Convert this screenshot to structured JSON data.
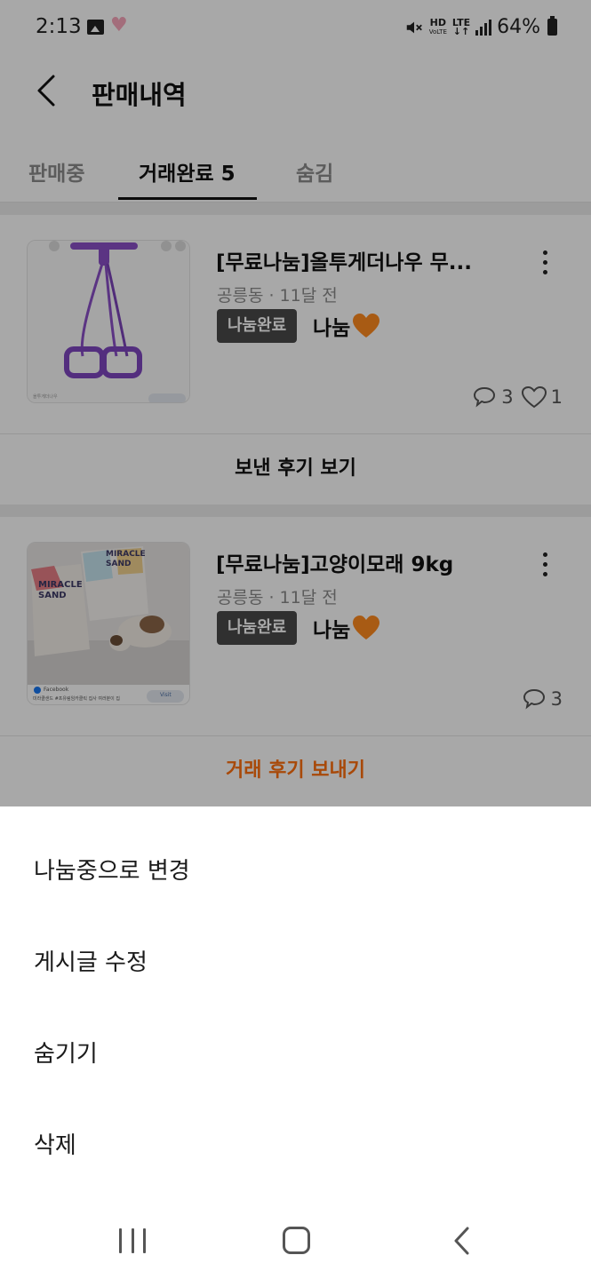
{
  "status_bar": {
    "time": "2:13",
    "hd_label": "HD",
    "hd_sub": "VoLTE",
    "lte_label": "LTE",
    "battery": "64%",
    "icons": [
      "gallery-icon",
      "heart-icon",
      "mute-icon",
      "signal-icon",
      "battery-icon"
    ]
  },
  "header": {
    "title": "판매내역",
    "back_icon": "chevron-left-icon"
  },
  "tabs": [
    {
      "label": "판매중",
      "active": false
    },
    {
      "label": "거래완료 5",
      "active": true
    },
    {
      "label": "숨김",
      "active": false
    }
  ],
  "items": [
    {
      "title": "[무료나눔]올투게더나우 무...",
      "meta": "공릉동 · 11달 전",
      "status": "나눔완료",
      "price": "나눔",
      "chat_count": "3",
      "like_count": "1",
      "review_button": "보낸 후기 보기",
      "thumb_caption": "올투게더나우"
    },
    {
      "title": "[무료나눔]고양이모래 9kg",
      "meta": "공릉동 · 11달 전",
      "status": "나눔완료",
      "price": "나눔",
      "chat_count": "3",
      "review_button": "거래 후기 보내기",
      "thumb_text1": "MIRACLE SAND",
      "thumb_text2": "MIRACLE SAND",
      "thumb_source": "Facebook",
      "thumb_caption": "미라클샌드 #프유림임카클릭 집사 여러분이 집",
      "thumb_visit": "Visit"
    }
  ],
  "sheet": {
    "options": [
      "나눔중으로 변경",
      "게시글 수정",
      "숨기기",
      "삭제"
    ]
  },
  "colors": {
    "accent_orange": "#ff6f0f",
    "chip_bg": "#4a4a4a",
    "heart_orange": "#ff8a1f"
  }
}
